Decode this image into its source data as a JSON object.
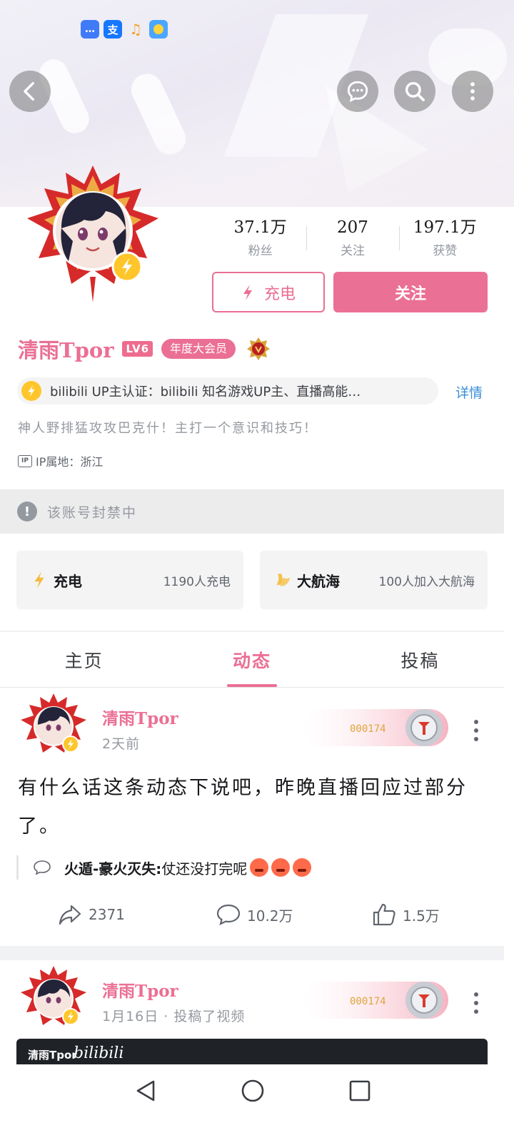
{
  "profile": {
    "name": "清雨Tpor",
    "level": "LV6",
    "vip_label": "年度大会员",
    "stats": [
      {
        "value": "37.1万",
        "label": "粉丝"
      },
      {
        "value": "207",
        "label": "关注"
      },
      {
        "value": "197.1万",
        "label": "获赞"
      }
    ],
    "charge_label": "充电",
    "follow_label": "关注",
    "auth_text": "bilibili UP主认证：bilibili 知名游戏UP主、直播高能…",
    "auth_detail": "详情",
    "bio": "神人野排猛攻攻巴克什！主打一个意识和技巧！",
    "ip_badge": "IP",
    "ip_text": "IP属地：浙江"
  },
  "ban_notice": "该账号封禁中",
  "cards": [
    {
      "title": "充电",
      "sub": "1190人充电",
      "icon": "bolt-icon"
    },
    {
      "title": "大航海",
      "sub": "100人加入大航海",
      "icon": "ship-icon"
    }
  ],
  "tabs": [
    {
      "label": "主页",
      "active": false
    },
    {
      "label": "动态",
      "active": true
    },
    {
      "label": "投稿",
      "active": false
    }
  ],
  "posts": [
    {
      "author": "清雨Tpor",
      "time": "2天前",
      "fan_number": "000174",
      "text": "有什么话这条动态下说吧，昨晚直播回应过部分了。",
      "comment_author": "火遁-豪火灭失:",
      "comment_text": "仗还没打完呢",
      "shares": "2371",
      "comments": "10.2万",
      "likes": "1.5万"
    },
    {
      "author": "清雨Tpor",
      "time": "1月16日 · 投稿了视频",
      "fan_number": "000174",
      "video_name": "清雨Tpor",
      "video_logo": "bilibili"
    }
  ],
  "colors": {
    "accent": "#eb6f95",
    "link": "#3a8fd6",
    "muted": "#9499a0",
    "gold": "#ffc62c"
  }
}
